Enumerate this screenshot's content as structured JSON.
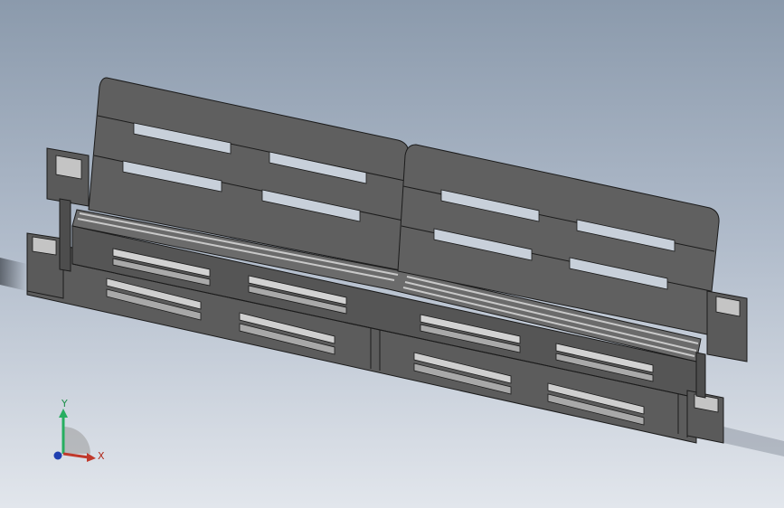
{
  "viewport": {
    "name": "graphics-area",
    "colors": {
      "background_top": "#8b9aac",
      "background_bottom": "#e2e6ec",
      "part_face": "#5e5e5e",
      "part_dark": "#3a3a3a",
      "part_light": "#bdbdbd",
      "edge": "#1b1b1b"
    }
  },
  "model": {
    "description_icon": "pallet-sofa-model",
    "parts": [
      "backrest-left",
      "backrest-right",
      "seat-pallet-upper",
      "seat-pallet-lower",
      "armrest-left",
      "armrest-right"
    ]
  },
  "triad": {
    "x_label": "X",
    "y_label": "Y",
    "x_color": "#c0392b",
    "y_color": "#27ae60",
    "z_color": "#1f3fb0"
  }
}
